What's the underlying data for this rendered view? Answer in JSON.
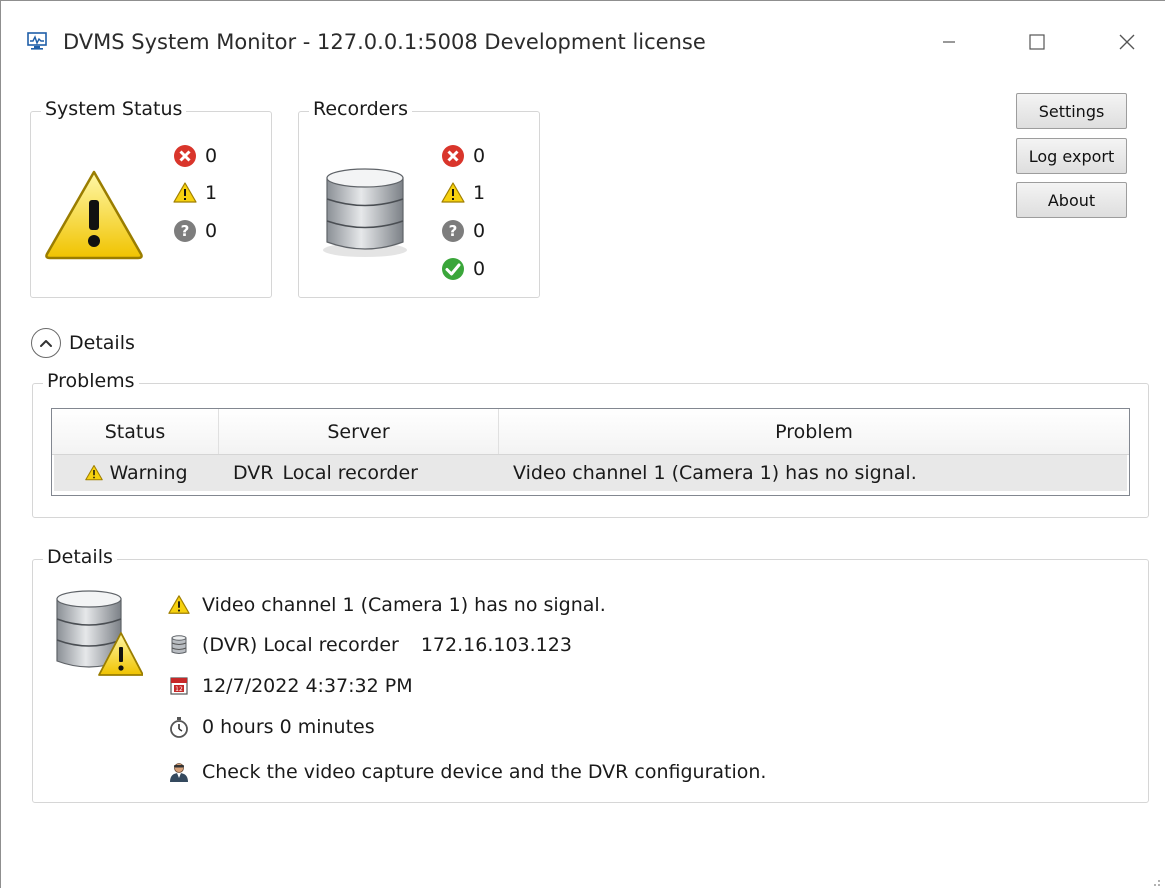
{
  "window": {
    "title": "DVMS System Monitor - 127.0.0.1:5008 Development license",
    "controls": [
      "minimize-icon",
      "maximize-icon",
      "close-icon"
    ]
  },
  "system_status": {
    "title": "System Status",
    "errors": "0",
    "warnings": "1",
    "unknown": "0"
  },
  "recorders": {
    "title": "Recorders",
    "errors": "0",
    "warnings": "1",
    "unknown": "0",
    "ok": "0"
  },
  "buttons": {
    "settings": "Settings",
    "log_export": "Log export",
    "about": "About"
  },
  "expander": {
    "label": "Details"
  },
  "problems": {
    "title": "Problems",
    "columns": [
      "Status",
      "Server",
      "Problem"
    ],
    "rows": [
      {
        "status": "Warning",
        "server": "DVR",
        "server_name": "Local recorder",
        "problem": "Video channel 1 (Camera 1) has no signal."
      }
    ]
  },
  "details": {
    "title": "Details",
    "message": "Video channel 1 (Camera 1) has no signal.",
    "recorder": "(DVR) Local recorder",
    "ip": "172.16.103.123",
    "timestamp": "12/7/2022 4:37:32 PM",
    "duration": "0 hours 0 minutes",
    "action": "Check the video capture device and the DVR configuration."
  },
  "colors": {
    "warning": "#f6d10f",
    "error": "#d9352b",
    "unknown": "#7d7d7d",
    "ok": "#3aa63a",
    "row_highlight": "#e8e8e8"
  }
}
